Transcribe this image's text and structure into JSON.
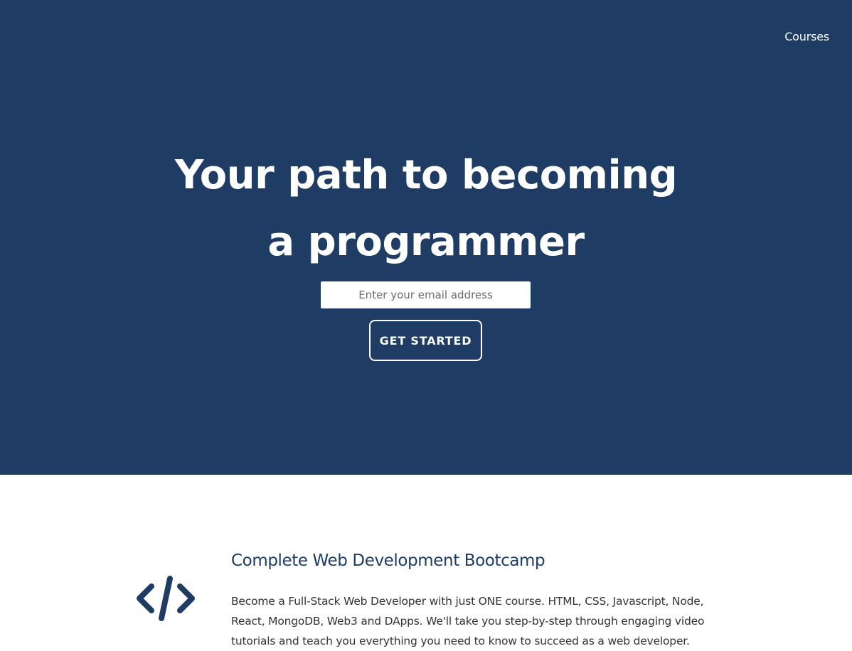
{
  "nav": {
    "courses_label": "Courses"
  },
  "hero": {
    "headline_line1": "Your path to becoming",
    "headline_line2": "a programmer",
    "email_placeholder": "Enter your email address",
    "cta_label": "GET STARTED"
  },
  "course": {
    "icon": "code-icon",
    "title": "Complete Web Development Bootcamp",
    "description": "Become a Full-Stack Web Developer with just ONE course. HTML, CSS, Javascript, Node, React, MongoDB, Web3 and DApps. We'll take you step-by-step through engaging video tutorials and teach you everything you need to know to succeed as a web developer."
  },
  "colors": {
    "hero_background": "#1e3c64",
    "accent": "#1e3c64",
    "text": "#333333",
    "white": "#ffffff"
  }
}
